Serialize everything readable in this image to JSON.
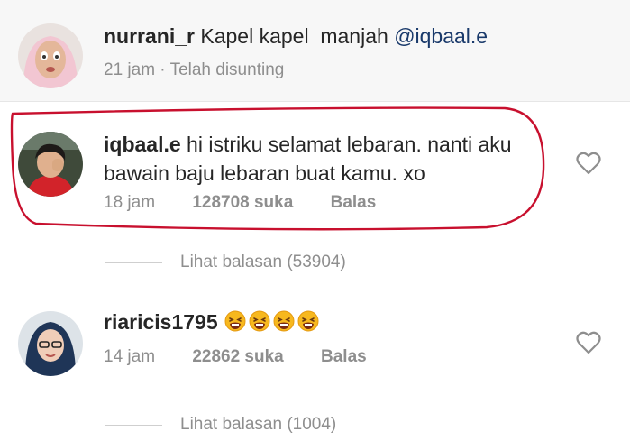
{
  "comments": [
    {
      "username": "nurrani_r",
      "text": " Kapel kapel  manjah ",
      "mention": "@iqbaal.e",
      "time": "21 jam · Telah disunting"
    },
    {
      "username": "iqbaal.e",
      "text_line1": "hi istriku selamat lebaran. nanti aku",
      "text_line2": "bawain baju lebaran buat kamu. xo",
      "time": "18 jam",
      "likes": "128708 suka",
      "reply": "Balas",
      "view_replies": "Lihat balasan (53904)"
    },
    {
      "username": "riaricis1795",
      "emoji_count": 4,
      "emoji_name": "tired-face-emoji",
      "time": "14 jam",
      "likes": "22862 suka",
      "reply": "Balas",
      "view_replies": "Lihat balasan (1004)"
    }
  ],
  "icons": {
    "like": "heart-outline-icon"
  },
  "colors": {
    "highlight": "#c8102e",
    "mention": "#1a3a6b",
    "meta": "#8e8e8e",
    "background_top": "#f7f7f7"
  }
}
